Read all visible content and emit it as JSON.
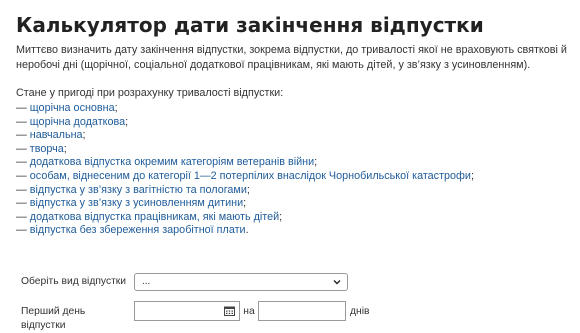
{
  "title": "Калькулятор дати закінчення відпустки",
  "intro": "Миттєво визначить дату закінчення відпустки, зокрема відпустки, до тривалості якої не враховують святкові й неробочі дні (щорічної, соціальної додаткової працівникам, які мають дітей, у зв’язку з усиновленням).",
  "lead": "Стане у пригоді при розрахунку тривалості відпустки:",
  "dash": "—",
  "types": [
    {
      "text": "щорічна основна",
      "punct": ";"
    },
    {
      "text": "щорічна додаткова",
      "punct": ";"
    },
    {
      "text": "навчальна",
      "punct": ";"
    },
    {
      "text": "творча",
      "punct": ";"
    },
    {
      "text": "додаткова відпустка окремим категоріям ветеранів війни",
      "punct": ";"
    },
    {
      "text": "особам, віднесеним до категорії 1—2 потерпілих внаслідок Чорнобильської катастрофи",
      "punct": ";"
    },
    {
      "text": "відпустка у зв’язку з вагітністю та пологами",
      "punct": ";"
    },
    {
      "text": "відпустка у зв’язку з усиновленням дитини",
      "punct": ";"
    },
    {
      "text": "додаткова відпустка працівникам, які мають дітей",
      "punct": ";"
    },
    {
      "text": "відпустка без збереження заробітної плати",
      "punct": "."
    }
  ],
  "form": {
    "type_label": "Оберіть вид відпустки",
    "type_selected": "...",
    "first_day_label": "Перший день відпустки",
    "first_day_value": "",
    "on_label": "на",
    "days_value": "",
    "days_unit": "днів"
  },
  "colors": {
    "link": "#1f5c99",
    "text": "#333333",
    "title": "#222222",
    "border": "#9a9a9a"
  },
  "icons": {
    "select": "chevron-down-icon",
    "date": "calendar-icon"
  }
}
